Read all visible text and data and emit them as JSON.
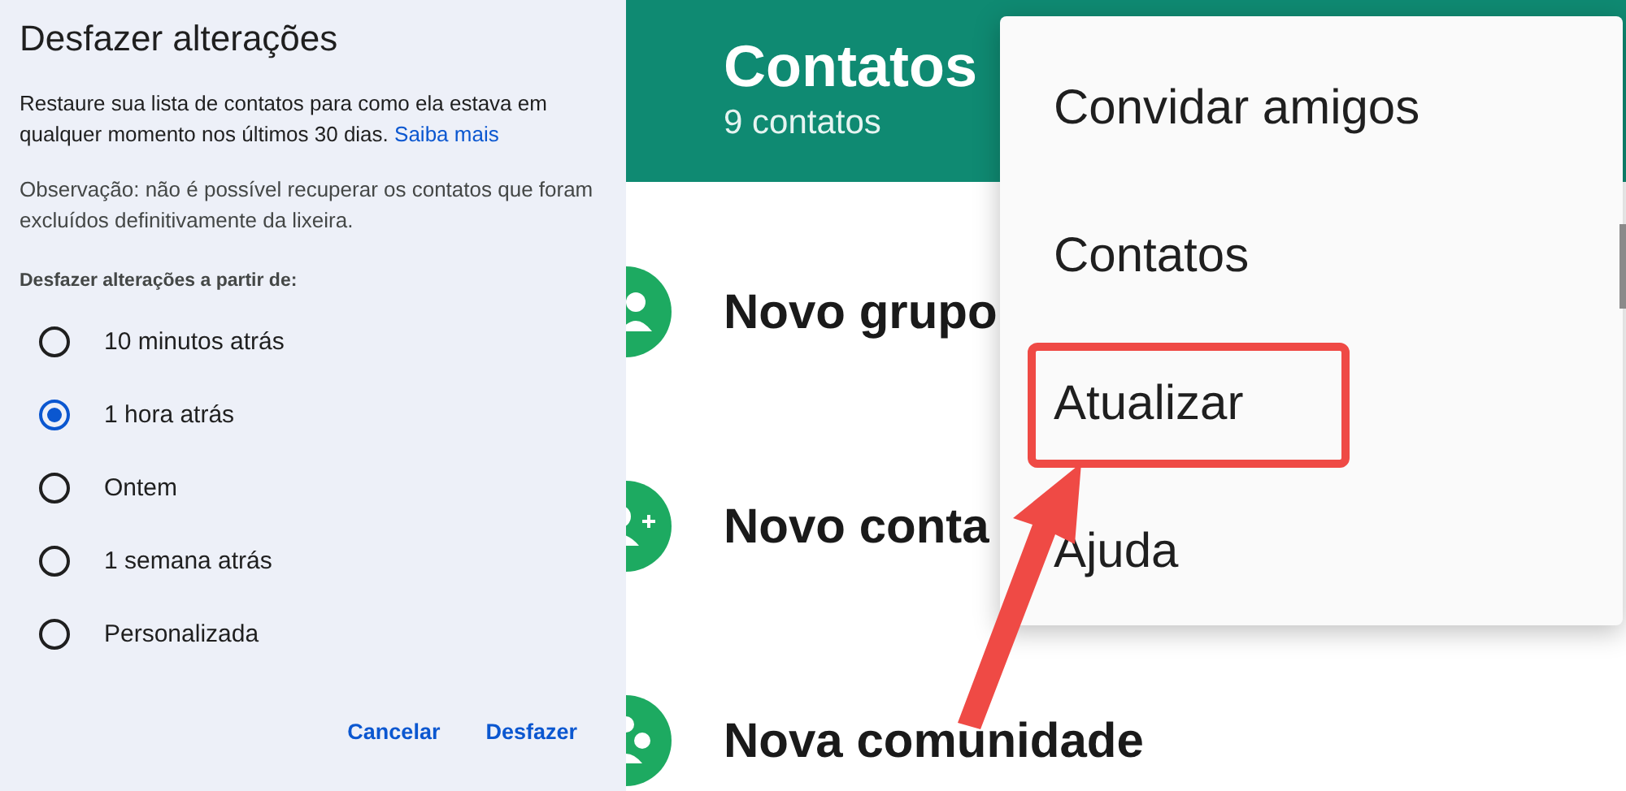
{
  "undo_dialog": {
    "title": "Desfazer alterações",
    "description": "Restaure sua lista de contatos para como ela estava em qualquer momento nos últimos 30 dias.",
    "learn_more_link": "Saiba mais",
    "note": "Observação: não é possível recuperar os contatos que foram excluídos definitivamente da lixeira.",
    "options_label": "Desfazer alterações a partir de:",
    "options": [
      {
        "label": "10 minutos atrás",
        "selected": false
      },
      {
        "label": "1 hora atrás",
        "selected": true
      },
      {
        "label": "Ontem",
        "selected": false
      },
      {
        "label": "1 semana atrás",
        "selected": false
      },
      {
        "label": "Personalizada",
        "selected": false
      }
    ],
    "buttons": [
      "Cancelar",
      "Desfazer"
    ]
  },
  "contacts_screen": {
    "title": "Contatos",
    "subtitle": "9 contatos",
    "rows": [
      {
        "label": "Novo grupo",
        "kind": "group"
      },
      {
        "label": "Novo conta",
        "kind": "contact"
      },
      {
        "label": "Nova comunidade",
        "kind": "community"
      }
    ],
    "menu": [
      {
        "label": "Convidar amigos",
        "highlighted": false
      },
      {
        "label": "Contatos",
        "highlighted": false
      },
      {
        "label": "Atualizar",
        "highlighted": true
      },
      {
        "label": "Ajuda",
        "highlighted": false
      }
    ]
  }
}
